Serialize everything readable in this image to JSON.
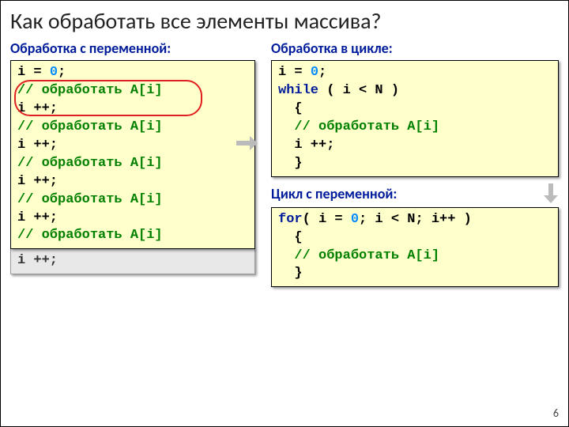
{
  "title": "Как обработать все элементы массива?",
  "left": {
    "heading": "Обработка с переменной:",
    "code": {
      "l1a": "i = ",
      "l1b": "0",
      "l1c": ";",
      "cmt": "// обработать A[i]",
      "inc": "i ++;"
    },
    "extra": "i ++;"
  },
  "right": {
    "heading1": "Обработка в цикле:",
    "code1": {
      "l1a": "i = ",
      "l1b": "0",
      "l1c": ";",
      "l2a": "while",
      "l2b": " ( i < N )",
      "l3": "  {",
      "l4": "  // обработать A[i]",
      "l5": "  i ++;",
      "l6": "  }"
    },
    "heading2": "Цикл с переменной:",
    "code2": {
      "l1a": "for",
      "l1b": "( i = ",
      "l1c": "0",
      "l1d": "; i < N; i++ )",
      "l2": "  {",
      "l3": "  // обработать A[i]",
      "l4": "  }"
    }
  },
  "pagenum": "6"
}
